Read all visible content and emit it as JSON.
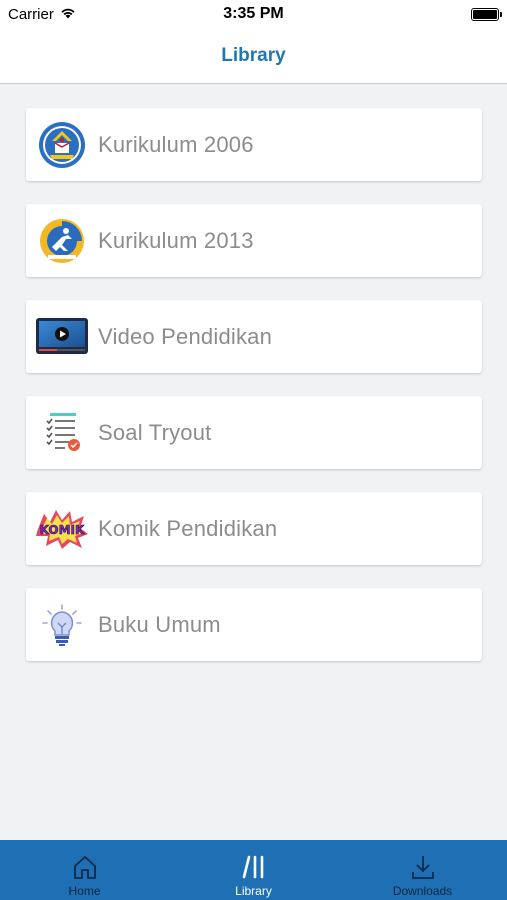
{
  "status_bar": {
    "carrier": "Carrier",
    "time": "3:35 PM"
  },
  "nav": {
    "title": "Library"
  },
  "items": [
    {
      "label": "Kurikulum 2006",
      "icon": "tut-wuri-emblem-icon"
    },
    {
      "label": "Kurikulum 2013",
      "icon": "kurikulum-2013-logo-icon"
    },
    {
      "label": "Video Pendidikan",
      "icon": "video-player-icon"
    },
    {
      "label": "Soal Tryout",
      "icon": "checklist-icon"
    },
    {
      "label": "Komik Pendidikan",
      "icon": "komik-logo-icon"
    },
    {
      "label": "Buku Umum",
      "icon": "lightbulb-icon"
    }
  ],
  "komik_logo_text": "KOMIK",
  "tabs": [
    {
      "label": "Home",
      "icon": "home-icon",
      "active": false
    },
    {
      "label": "Library",
      "icon": "library-icon",
      "active": true
    },
    {
      "label": "Downloads",
      "icon": "download-icon",
      "active": false
    }
  ],
  "colors": {
    "accent": "#1f78b4",
    "tab_bar": "#1e6fb3",
    "background": "#f1f2f4"
  }
}
